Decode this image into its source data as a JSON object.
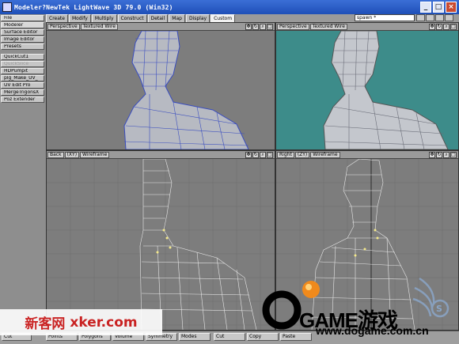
{
  "window": {
    "title": "Modeler?NewTek LightWave 3D 79.0 (Win32)",
    "minimize": "_",
    "maximize": "□",
    "close": "×"
  },
  "left_panel": {
    "items": [
      {
        "label": "File",
        "kind": "menu"
      },
      {
        "label": "Modeler",
        "kind": "menu"
      },
      {
        "label": "Surface Editor",
        "kind": "button"
      },
      {
        "label": "Image Editor",
        "kind": "button"
      },
      {
        "label": "Presets",
        "kind": "button"
      },
      {
        "label": "QuickCut1",
        "kind": "button"
      },
      {
        "label": "QuickSlice",
        "kind": "disabled"
      },
      {
        "label": "HDPumpit",
        "kind": "button"
      },
      {
        "label": "plg_Make_UV_",
        "kind": "button"
      },
      {
        "label": "UV Edit Pro",
        "kind": "button"
      },
      {
        "label": "MergeTrigonsX",
        "kind": "button"
      },
      {
        "label": "Poz Extender",
        "kind": "button"
      }
    ]
  },
  "tabs": [
    {
      "label": "Create",
      "active": false
    },
    {
      "label": "Modify",
      "active": false
    },
    {
      "label": "Multiply",
      "active": false
    },
    {
      "label": "Construct",
      "active": false
    },
    {
      "label": "Detail",
      "active": false
    },
    {
      "label": "Map",
      "active": false
    },
    {
      "label": "Display",
      "active": false
    },
    {
      "label": "Custom",
      "active": true
    }
  ],
  "layer_selector": {
    "value": "spawn *"
  },
  "viewports": [
    {
      "view": "Perspective",
      "axis": "",
      "mode": "Textured Wire",
      "background": "#7d7d7d"
    },
    {
      "view": "Perspective",
      "axis": "",
      "mode": "Textured Wire",
      "background": "#3d8c8a"
    },
    {
      "view": "Back",
      "axis": "(XY)",
      "mode": "Wireframe",
      "background": "#7d7d7d"
    },
    {
      "view": "Right",
      "axis": "(ZY)",
      "mode": "Wireframe",
      "background": "#7d7d7d"
    }
  ],
  "bottom_bar": {
    "items": [
      "Cut",
      "Points",
      "Polygons",
      "Volume",
      "Symmetry",
      "Modes",
      "Cut",
      "Copy",
      "Paste"
    ]
  },
  "watermarks": {
    "left_cn": "新客网",
    "left_en": "xker.com",
    "brand": "GAME游戏",
    "url": "www.dogame.com.cn"
  },
  "colors": {
    "title_bar": "#2c5fcc",
    "mesh_wire": "#3a4dbf",
    "teal_bg": "#3d8c8a",
    "watermark_red": "#d21919"
  }
}
